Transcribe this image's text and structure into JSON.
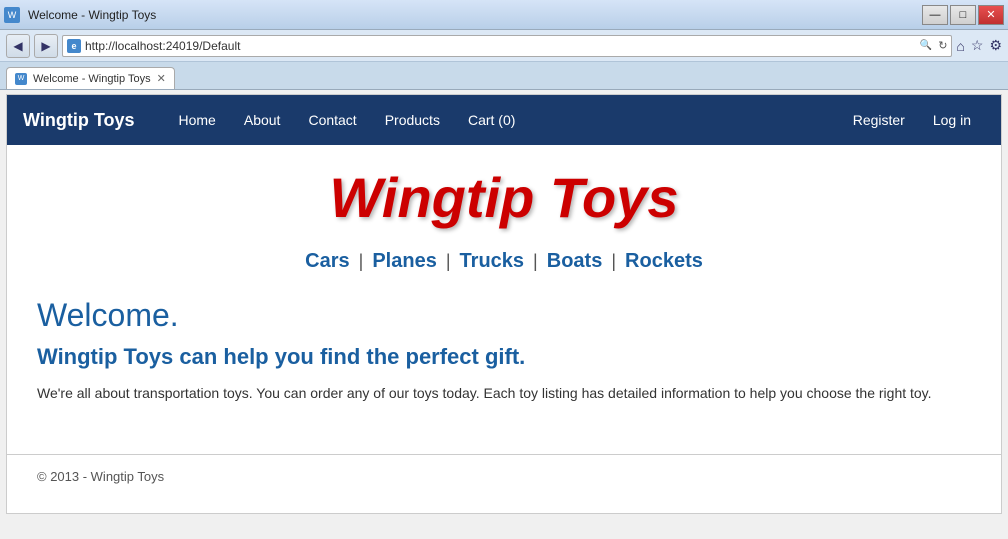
{
  "window": {
    "title": "Welcome - Wingtip Toys",
    "controls": {
      "minimize": "—",
      "maximize": "□",
      "close": "✕"
    }
  },
  "browser": {
    "address": "http://localhost:24019/Default",
    "tab_label": "Welcome - Wingtip Toys",
    "tab_favicon": "W",
    "address_icon_text": "e",
    "nav_back": "◀",
    "nav_forward": "▶",
    "refresh": "↻",
    "search_placeholder": "Search",
    "home_icon": "⌂",
    "star_icon": "☆",
    "settings_icon": "⚙"
  },
  "site": {
    "brand": "Wingtip Toys",
    "nav": {
      "home": "Home",
      "about": "About",
      "contact": "Contact",
      "products": "Products",
      "cart": "Cart (0)",
      "register": "Register",
      "login": "Log in"
    },
    "logo_text": "Wingtip Toys",
    "categories": [
      {
        "label": "Cars",
        "id": "cars"
      },
      {
        "label": "Planes",
        "id": "planes"
      },
      {
        "label": "Trucks",
        "id": "trucks"
      },
      {
        "label": "Boats",
        "id": "boats"
      },
      {
        "label": "Rockets",
        "id": "rockets"
      }
    ],
    "main": {
      "heading": "Welcome.",
      "subheading": "Wingtip Toys can help you find the perfect gift.",
      "body": "We're all about transportation toys. You can order any of our toys today. Each toy listing has detailed information to help you choose the right toy."
    },
    "footer": {
      "text": "© 2013 - Wingtip Toys"
    }
  }
}
